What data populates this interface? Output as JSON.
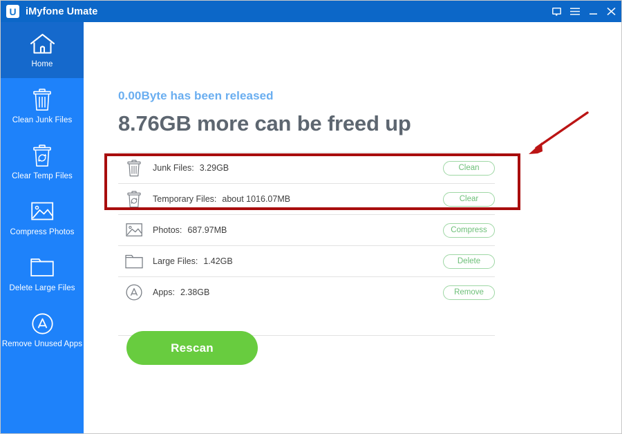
{
  "window": {
    "app_title": "iMyfone Umate",
    "logo_letter": "U",
    "controls": [
      {
        "name": "feedback-icon",
        "label": "Feedback"
      },
      {
        "name": "menu-icon",
        "label": "Menu"
      },
      {
        "name": "minimize-icon",
        "label": "Minimize"
      },
      {
        "name": "close-icon",
        "label": "Close"
      }
    ]
  },
  "sidebar": {
    "items": [
      {
        "label": "Home",
        "icon": "home-icon",
        "active": true
      },
      {
        "label": "Clean Junk Files",
        "icon": "trash-icon",
        "active": false
      },
      {
        "label": "Clear Temp Files",
        "icon": "recycle-bin-icon",
        "active": false
      },
      {
        "label": "Compress Photos",
        "icon": "photo-icon",
        "active": false
      },
      {
        "label": "Delete Large Files",
        "icon": "folder-icon",
        "active": false
      },
      {
        "label": "Remove Unused Apps",
        "icon": "app-store-icon",
        "active": false
      }
    ]
  },
  "main": {
    "released_text": "0.00Byte has been released",
    "headline": "8.76GB more can be freed up",
    "rows": [
      {
        "icon": "trash-icon",
        "label": "Junk Files:",
        "value": "3.29GB",
        "action": "Clean"
      },
      {
        "icon": "recycle-bin-icon",
        "label": "Temporary Files:",
        "value": "about 1016.07MB",
        "action": "Clear"
      },
      {
        "icon": "photo-icon",
        "label": "Photos:",
        "value": "687.97MB",
        "action": "Compress"
      },
      {
        "icon": "folder-icon",
        "label": "Large Files:",
        "value": "1.42GB",
        "action": "Delete"
      },
      {
        "icon": "app-store-icon",
        "label": "Apps:",
        "value": "2.38GB",
        "action": "Remove"
      }
    ],
    "rescan_label": "Rescan"
  },
  "colors": {
    "titlebar": "#0c67c8",
    "sidebar": "#1e82fa",
    "sidebar_active": "#1569cc",
    "headline_text": "#5d6670",
    "released_text": "#6aaef0",
    "action_green": "#6dbf78",
    "rescan_green": "#68cc3f",
    "annotation_red": "#a80d0d"
  },
  "annotations": {
    "highlight_box": "red-highlight-box",
    "arrow": "red-pointer-arrow"
  }
}
